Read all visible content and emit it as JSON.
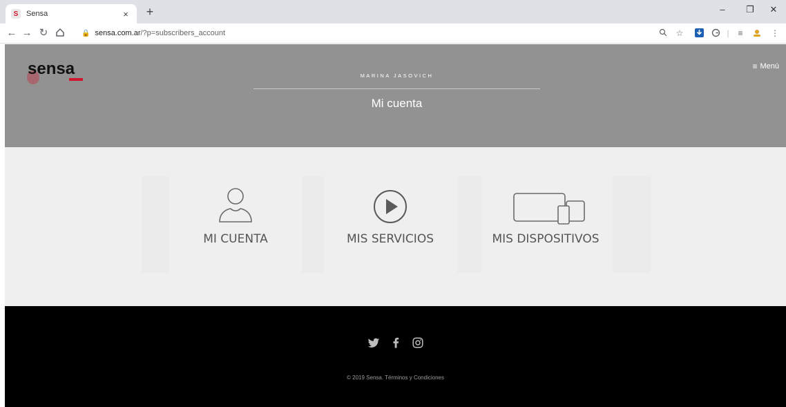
{
  "browser": {
    "tab_title": "Sensa",
    "favicon_letter": "S",
    "url_host": "sensa.com.ar",
    "url_path": "/?p=subscribers_account",
    "close_glyph": "×",
    "newtab_glyph": "+",
    "minimize_glyph": "–",
    "restore_glyph": "❐",
    "winclose_glyph": "✕"
  },
  "header": {
    "logo_text": "sensa",
    "menu_label": "Menú",
    "subheading": "MARINA JASOVICH",
    "title": "Mi cuenta"
  },
  "cards": [
    {
      "label": "MI CUENTA",
      "icon": "user-icon"
    },
    {
      "label": "MIS SERVICIOS",
      "icon": "play-circle-icon"
    },
    {
      "label": "MIS DISPOSITIVOS",
      "icon": "devices-icon"
    }
  ],
  "footer": {
    "social": [
      "twitter-icon",
      "facebook-icon",
      "instagram-icon"
    ],
    "copyright": "© 2019 Sensa. Términos y Condiciones"
  },
  "colors": {
    "hero_bg": "#929292",
    "content_bg": "#efefef",
    "footer_bg": "#000000",
    "brand_red": "#d1172d"
  }
}
